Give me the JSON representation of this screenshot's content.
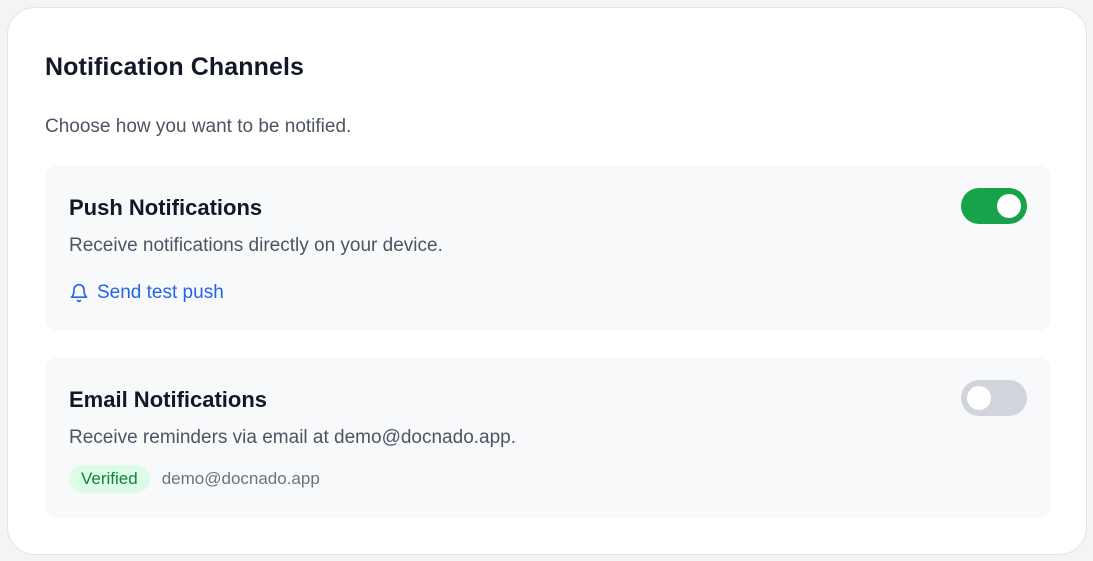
{
  "section": {
    "title": "Notification Channels",
    "subtitle": "Choose how you want to be notified."
  },
  "channels": {
    "push": {
      "title": "Push Notifications",
      "description": "Receive notifications directly on your device.",
      "enabled": true,
      "test_link_label": "Send test push",
      "test_link_icon": "bell-icon"
    },
    "email": {
      "title": "Email Notifications",
      "description": "Receive reminders via email at demo@docnado.app.",
      "enabled": false,
      "badge_label": "Verified",
      "address": "demo@docnado.app"
    }
  },
  "colors": {
    "toggle_on": "#16a34a",
    "toggle_off": "#d1d5db",
    "link": "#2563eb",
    "badge_bg": "#dcfce7",
    "badge_text": "#15803d"
  }
}
